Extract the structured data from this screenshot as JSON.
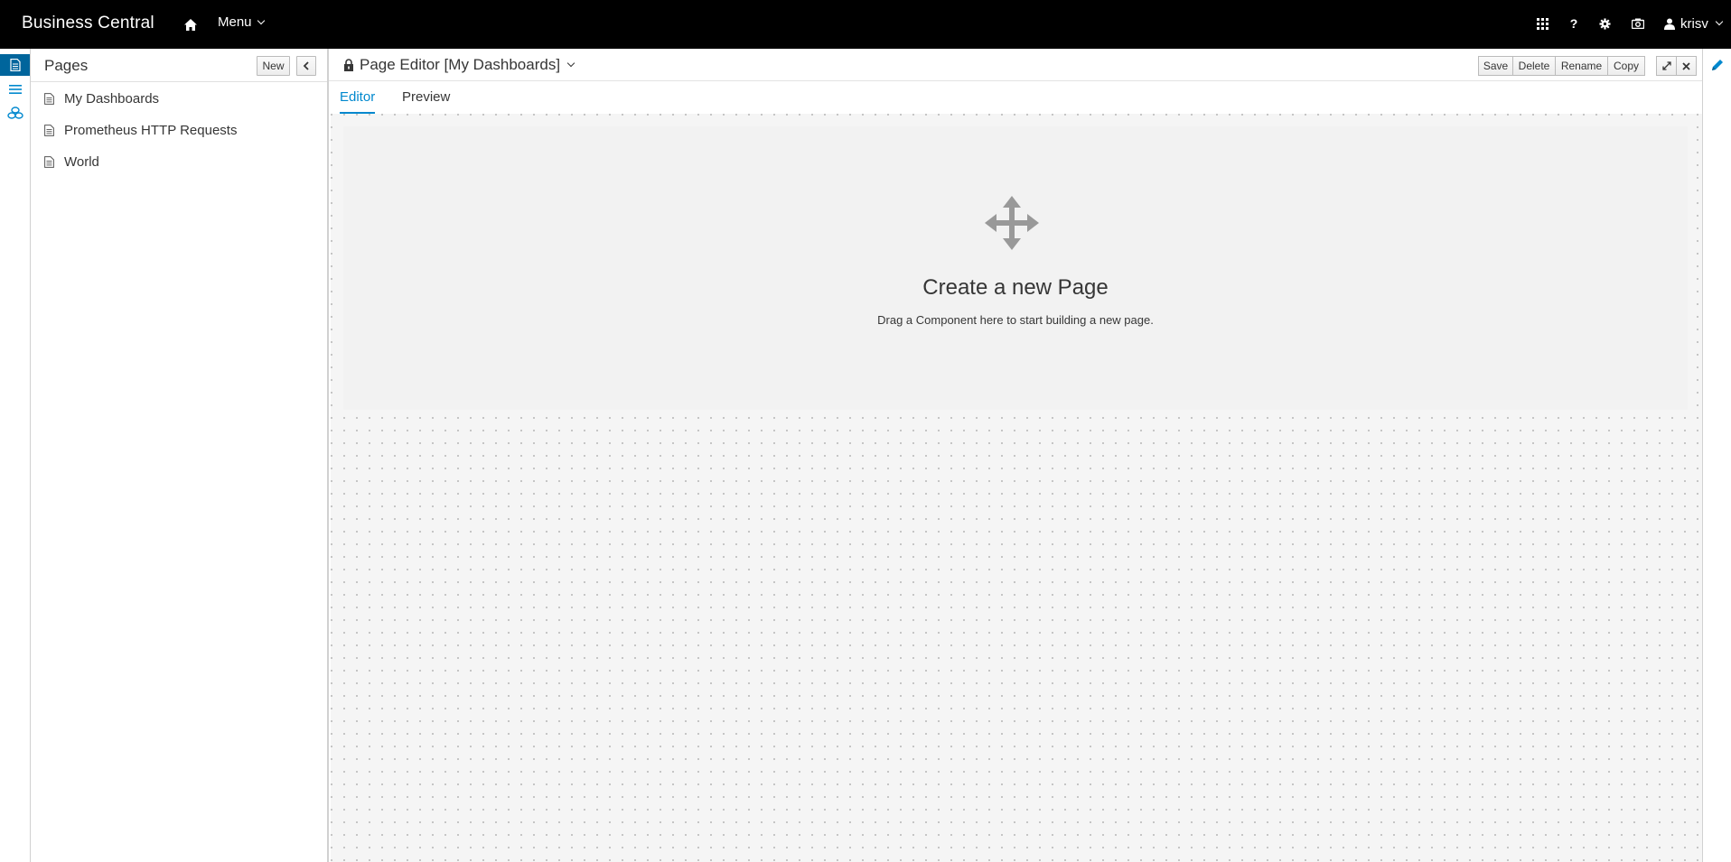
{
  "navbar": {
    "brand": "Business Central",
    "home_icon": "home-icon",
    "menu_label": "Menu",
    "help_label": "?",
    "user_name": "krisv",
    "icons": [
      "apps-grid-icon",
      "help-icon",
      "settings-gear-icon",
      "camera-icon",
      "user-icon"
    ]
  },
  "rail": {
    "items": [
      "pages-icon",
      "navigation-list-icon",
      "data-sets-icon"
    ]
  },
  "pages_panel": {
    "title": "Pages",
    "new_label": "New",
    "pages": [
      {
        "label": "My Dashboards",
        "icon": "document-icon"
      },
      {
        "label": "Prometheus HTTP Requests",
        "icon": "document-icon"
      },
      {
        "label": "World",
        "icon": "document-icon"
      }
    ]
  },
  "editor": {
    "title": "Page Editor [My Dashboards]",
    "toolbar": {
      "save": "Save",
      "delete": "Delete",
      "rename": "Rename",
      "copy": "Copy"
    },
    "tabs": [
      {
        "label": "Editor",
        "active": true
      },
      {
        "label": "Preview",
        "active": false
      }
    ],
    "drop_zone": {
      "title": "Create a new Page",
      "subtitle": "Drag a Component here to start building a new page.",
      "icon": "move-arrows-icon"
    }
  },
  "colors": {
    "navbar_bg": "#000000",
    "accent": "#0088ce",
    "rail_active": "#00659c"
  }
}
